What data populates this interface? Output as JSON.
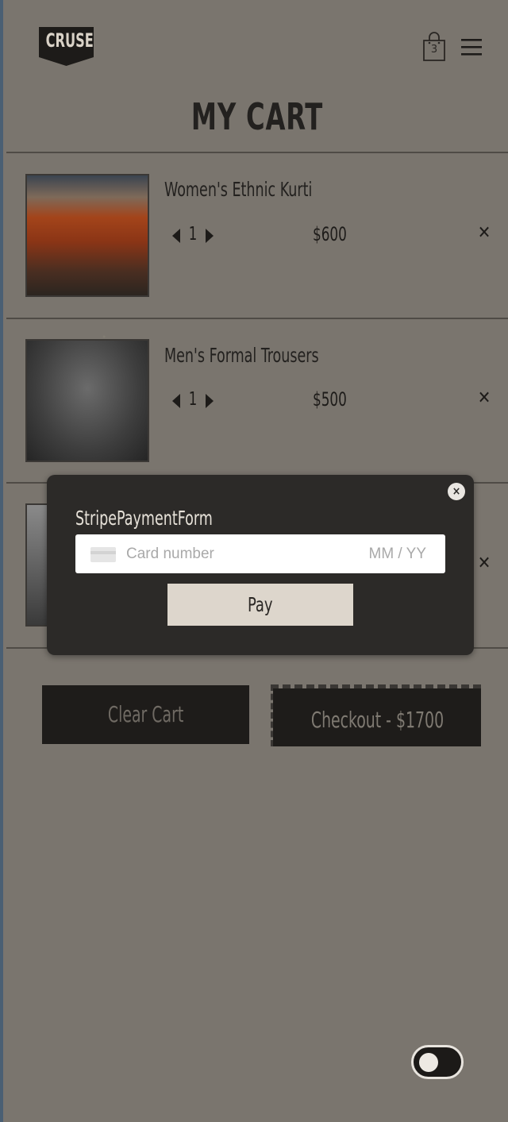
{
  "brand": {
    "logo_text": "CRUSE"
  },
  "header": {
    "cart_count": "3",
    "page_title": "MY CART"
  },
  "cart_items": [
    {
      "name": "Women's Ethnic Kurti",
      "quantity": "1",
      "price": "$600"
    },
    {
      "name": "Men's Formal Trousers",
      "quantity": "1",
      "price": "$500"
    },
    {
      "name": "",
      "quantity": "",
      "price": ""
    }
  ],
  "payment_modal": {
    "title": "StripePaymentForm",
    "card_placeholder": "Card number",
    "expiry_placeholder": "MM / YY",
    "pay_label": "Pay",
    "close_label": "×"
  },
  "actions": {
    "clear_label": "Clear Cart",
    "checkout_label": "Checkout - $1700"
  },
  "remove_glyph": "✕",
  "colors": {
    "background": "#7a756e",
    "dark": "#1e1c1a",
    "modal": "#2c2a28"
  },
  "theme_toggle": {
    "state": "off"
  }
}
